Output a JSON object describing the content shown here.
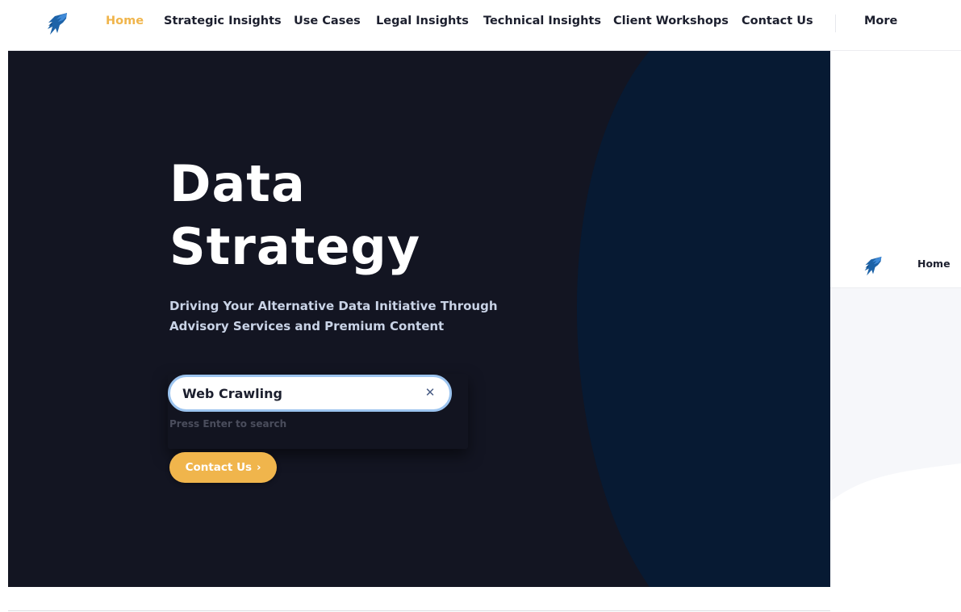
{
  "nav": {
    "items": [
      {
        "label": "Home",
        "active": true
      },
      {
        "label": "Strategic Insights",
        "active": false
      },
      {
        "label": "Use Cases",
        "active": false
      },
      {
        "label": "Legal Insights",
        "active": false
      },
      {
        "label": "Technical Insights",
        "active": false
      },
      {
        "label": "Client Workshops",
        "active": false
      },
      {
        "label": "Contact Us",
        "active": false
      }
    ],
    "more_label": "More",
    "logo_icon": "eagle-logo-icon"
  },
  "hero": {
    "title_line1": "Data",
    "title_line2": "Strategy",
    "subtitle_line1": "Driving Your Alternative Data Initiative Through",
    "subtitle_line2": "Advisory Services and Premium Content",
    "search": {
      "value": "Web Crawling",
      "clear_icon": "close-icon",
      "hint": "Press Enter to search"
    },
    "contact_button": {
      "label": "Contact Us",
      "icon": "chevron-right-icon"
    }
  },
  "inset": {
    "home_label": "Home",
    "logo_icon": "eagle-logo-icon"
  },
  "colors": {
    "accent": "#f0b54c",
    "hero_background": "#131522",
    "hero_curve": "#071a33",
    "nav_text": "#1c1f2e",
    "search_border": "#9cc4ef"
  }
}
